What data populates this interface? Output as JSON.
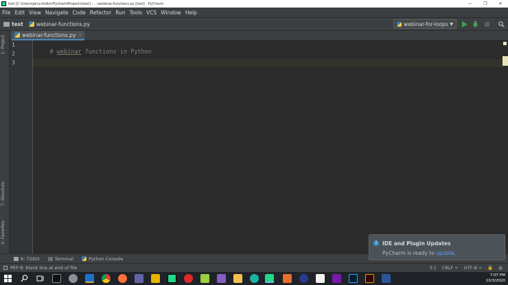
{
  "window": {
    "title": "test [C:\\Users\\jerry.stoller\\PycharmProjects\\test] - ...\\webinar-functions.py [test] - PyCharm",
    "controls": [
      "—",
      "❐",
      "✕"
    ]
  },
  "menu": [
    "File",
    "Edit",
    "View",
    "Navigate",
    "Code",
    "Refactor",
    "Run",
    "Tools",
    "VCS",
    "Window",
    "Help"
  ],
  "breadcrumb": {
    "project": "test",
    "file": "webinar-functions.py"
  },
  "run_config": {
    "label": "webinar-for-loops"
  },
  "side_tabs": {
    "project": "1: Project",
    "structure": "7: Structure",
    "favorites": "2: Favorites"
  },
  "editor_tab": {
    "label": "webinar-functions.py",
    "close": "×"
  },
  "editor": {
    "line_numbers": [
      "1",
      "2",
      "3"
    ],
    "line1_hash": "# ",
    "line1_word": "webinar",
    "line1_rest": " functions in Python",
    "current_line": 3
  },
  "bottom_tabs": [
    "6: TODO",
    "Terminal",
    "Python Console"
  ],
  "status": {
    "message": "PEP 8: blank line at end of file",
    "position": "3:1",
    "line_sep": "CRLF ÷",
    "encoding": "UTF-8 ÷"
  },
  "notification": {
    "title": "IDE and Plugin Updates",
    "body_text": "PyCharm is ready to ",
    "link": "update",
    "body_end": "."
  },
  "clock": {
    "time": "7:07 PM",
    "date": "10/3/2020"
  },
  "colors": {
    "accent": "#4a88c7",
    "run_green": "#499c54",
    "current_line_bg": "#32332c"
  }
}
